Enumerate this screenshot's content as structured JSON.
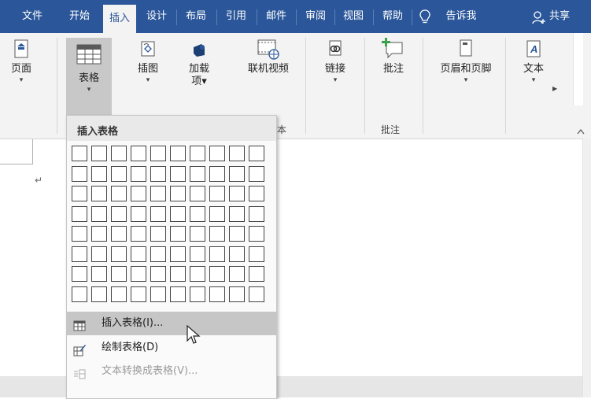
{
  "tabs": [
    {
      "label": "文件"
    },
    {
      "label": "开始"
    },
    {
      "label": "插入"
    },
    {
      "label": "设计"
    },
    {
      "label": "布局"
    },
    {
      "label": "引用"
    },
    {
      "label": "邮件"
    },
    {
      "label": "审阅"
    },
    {
      "label": "视图"
    },
    {
      "label": "帮助"
    }
  ],
  "tell_me": "告诉我",
  "share": "共享",
  "ribbon": {
    "page": {
      "label": "页面",
      "arrow": "▾"
    },
    "table": {
      "label": "表格",
      "arrow": "▾"
    },
    "illustrations": {
      "label": "插图",
      "arrow": "▾"
    },
    "addins": {
      "label1": "加载",
      "label2": "项▾"
    },
    "online_video": {
      "label": "联机视频"
    },
    "links": {
      "label": "链接",
      "arrow": "▾"
    },
    "comment": {
      "label": "批注"
    },
    "header_footer": {
      "label": "页眉和页脚",
      "arrow": "▾"
    },
    "text": {
      "label": "文本",
      "arrow": "▾"
    },
    "group_media_partial": "本",
    "group_comments": "批注"
  },
  "doc": {
    "paragraph_mark": "↵"
  },
  "menu": {
    "header": "插入表格",
    "grid_cols": 10,
    "grid_rows": 8,
    "items": [
      {
        "label": "插入表格(I)...",
        "state": "hover"
      },
      {
        "label": "绘制表格(D)",
        "state": "normal"
      },
      {
        "label": "文本转换成表格(V)...",
        "state": "disabled"
      }
    ]
  }
}
